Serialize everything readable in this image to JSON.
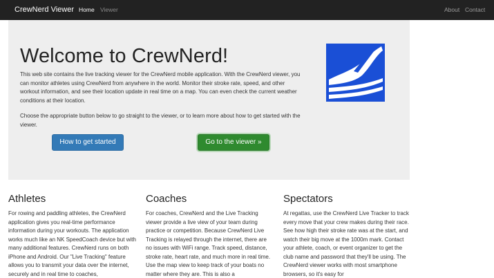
{
  "navbar": {
    "brand": "CrewNerd Viewer",
    "home": "Home",
    "viewer": "Viewer",
    "about": "About",
    "contact": "Contact"
  },
  "jumbotron": {
    "title": "Welcome to CrewNerd!",
    "p1": "This web site contains the live tracking viewer for the CrewNerd mobile application. With the CrewNerd viewer, you can monitor athletes using CrewNerd from anywhere in the world. Monitor their stroke rate, speed, and other workout information, and see their location update in real time on a map. You can even check the current weather conditions at their location.",
    "p2": "Choose the appropriate button below to go straight to the viewer, or to learn more about how to get started with the viewer.",
    "btn_start": "How to get started",
    "btn_viewer": "Go to the viewer »",
    "logo_icon": "crewnerd-logo-icon"
  },
  "columns": [
    {
      "title": "Athletes",
      "text": "For rowing and paddling athletes, the CrewNerd application gives you real-time performance information during your workouts. The application works much like an NK SpeedCoach device but with many additional features. CrewNerd runs on both iPhone and Android. Our \"Live Tracking\" feature allows you to transmit your data over the internet, securely and in real time to coaches,"
    },
    {
      "title": "Coaches",
      "text": "For coaches, CrewNerd and the Live Tracking viewer provide a live view of your team during practice or competition. Because CrewNerd Live Tracking is relayed through the internet, there are no issues with WiFi range. Track speed, distance, stroke rate, heart rate, and much more in real time. Use the map view to keep track of your boats no matter where they are. This is also a"
    },
    {
      "title": "Spectators",
      "text": "At regattas, use the CrewNerd Live Tracker to track every move that your crew makes during their race. See how high their stroke rate was at the start, and watch their big move at the 1000m mark. Contact your athlete, coach, or event organizer to get the club name and password that they'll be using. The CrewNerd viewer works with most smartphone browsers, so it's easy for"
    }
  ],
  "colors": {
    "navbar": "#222222",
    "jumbotron": "#eeeeee",
    "primary": "#337ab7",
    "success": "#2f8a2f",
    "logo_blue": "#1a4fd6"
  }
}
